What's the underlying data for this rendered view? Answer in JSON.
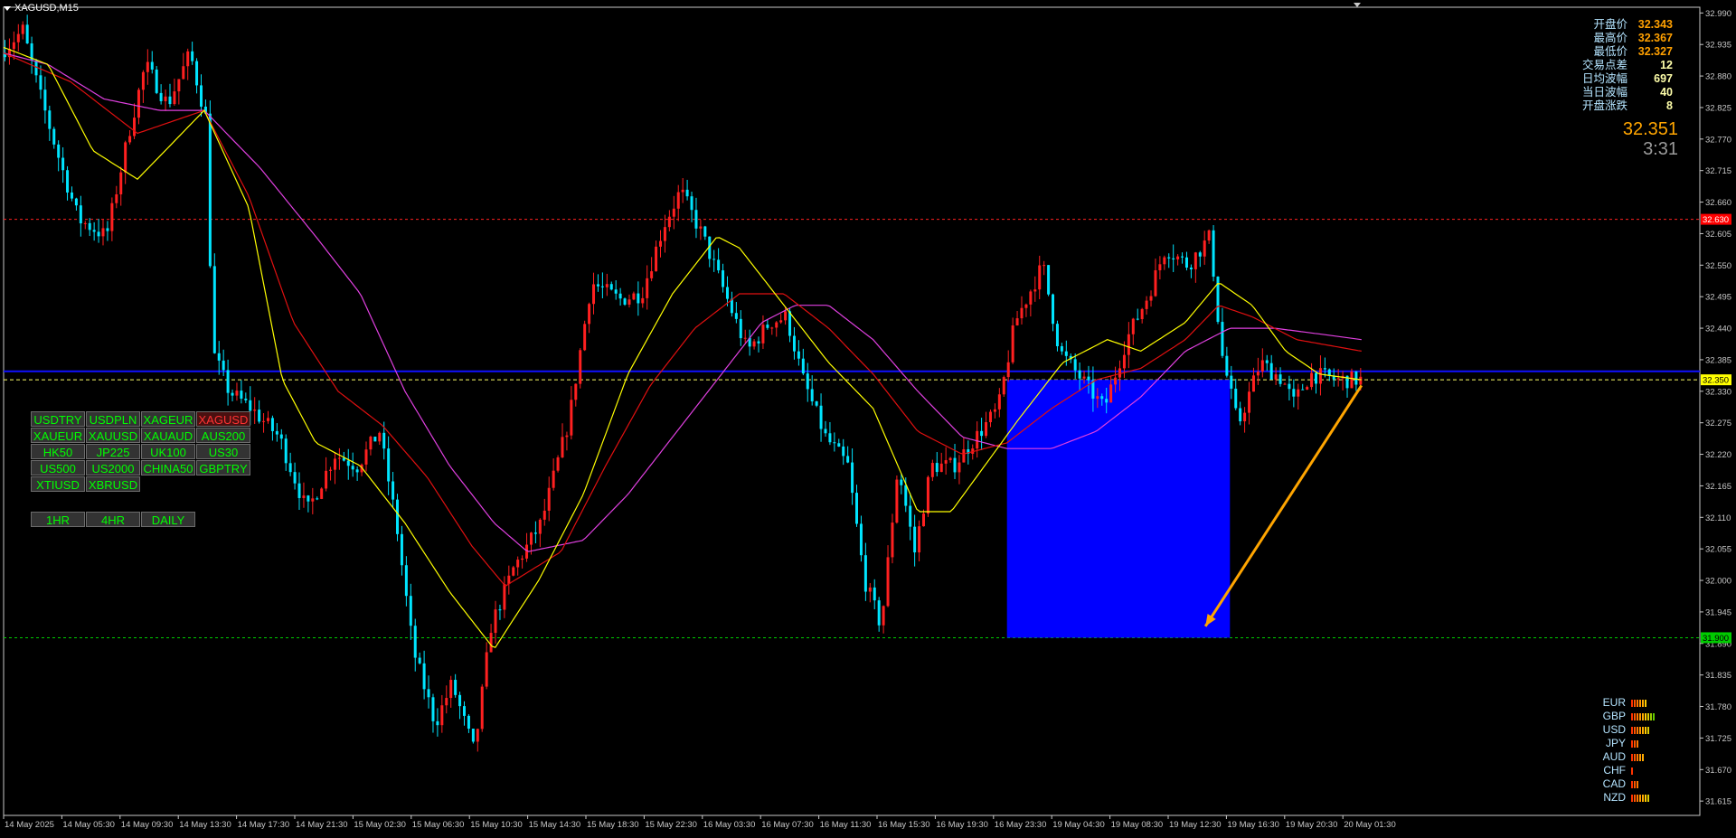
{
  "title": "XAGUSD,M15",
  "colors": {
    "background": "#000000",
    "bull": "#ff2020",
    "bear": "#00e5ff",
    "ma_fast": "#ffff00",
    "ma_mid": "#e01010",
    "ma_slow": "#e040e0",
    "resistance": "#ff2020",
    "support": "#00cc00",
    "current": "#ffff66",
    "blue_line": "#1010ff",
    "target_box": "#0000ff",
    "arrow": "#ffa500"
  },
  "symbols": {
    "rows": [
      [
        "USDTRY",
        "USDPLN",
        "XAGEUR",
        "XAGUSD"
      ],
      [
        "XAUEUR",
        "XAUUSD",
        "XAUAUD",
        "AUS200"
      ],
      [
        "HK50",
        "JP225",
        "UK100",
        "US30"
      ],
      [
        "US500",
        "US2000",
        "CHINA50",
        "GBPTRY"
      ],
      [
        "XTIUSD",
        "XBRUSD"
      ]
    ],
    "active": "XAGUSD"
  },
  "timeframes": [
    "1HR",
    "4HR",
    "DAILY"
  ],
  "info_panel": [
    {
      "label": "开盘价",
      "value": "32.343"
    },
    {
      "label": "最高价",
      "value": "32.367"
    },
    {
      "label": "最低价",
      "value": "32.327"
    },
    {
      "label": "交易点差",
      "value": "12"
    },
    {
      "label": "日均波幅",
      "value": "697"
    },
    {
      "label": "当日波幅",
      "value": "40"
    },
    {
      "label": "开盘涨跌",
      "value": "8"
    }
  ],
  "big_price": "32.351",
  "timer": "3:31",
  "currency_strength": [
    {
      "name": "EUR",
      "level": 6
    },
    {
      "name": "GBP",
      "level": 9
    },
    {
      "name": "USD",
      "level": 7
    },
    {
      "name": "JPY",
      "level": 3
    },
    {
      "name": "AUD",
      "level": 5
    },
    {
      "name": "CHF",
      "level": 1
    },
    {
      "name": "CAD",
      "level": 3
    },
    {
      "name": "NZD",
      "level": 7
    }
  ],
  "price_labels": {
    "resistance": "32.630",
    "current": "32.350",
    "support": "31.900"
  },
  "chart_data": {
    "type": "candlestick",
    "symbol": "XAGUSD",
    "timeframe": "M15",
    "ylim": [
      31.59,
      33.0
    ],
    "y_ticks": [
      "32.990",
      "32.935",
      "32.880",
      "32.825",
      "32.770",
      "32.715",
      "32.660",
      "32.605",
      "32.550",
      "32.495",
      "32.440",
      "32.385",
      "32.330",
      "32.275",
      "32.220",
      "32.165",
      "32.110",
      "32.055",
      "32.000",
      "31.945",
      "31.890",
      "31.835",
      "31.780",
      "31.725",
      "31.670",
      "31.615"
    ],
    "x_labels": [
      "14 May 2025",
      "14 May 05:30",
      "14 May 09:30",
      "14 May 13:30",
      "14 May 17:30",
      "14 May 21:30",
      "15 May 02:30",
      "15 May 06:30",
      "15 May 10:30",
      "15 May 14:30",
      "15 May 18:30",
      "15 May 22:30",
      "16 May 03:30",
      "16 May 07:30",
      "16 May 11:30",
      "16 May 15:30",
      "16 May 19:30",
      "16 May 23:30",
      "19 May 04:30",
      "19 May 08:30",
      "19 May 12:30",
      "19 May 16:30",
      "19 May 20:30",
      "20 May 01:30"
    ],
    "resistance_level": 32.63,
    "current_price": 32.35,
    "support_level": 31.9,
    "blue_line_level": 32.36,
    "price_path": [
      [
        0,
        32.92
      ],
      [
        20,
        32.96
      ],
      [
        35,
        32.85
      ],
      [
        55,
        32.72
      ],
      [
        70,
        32.63
      ],
      [
        95,
        32.6
      ],
      [
        115,
        32.78
      ],
      [
        130,
        32.9
      ],
      [
        150,
        32.83
      ],
      [
        170,
        32.92
      ],
      [
        185,
        32.8
      ],
      [
        190,
        32.4
      ],
      [
        205,
        32.33
      ],
      [
        225,
        32.3
      ],
      [
        250,
        32.25
      ],
      [
        275,
        32.12
      ],
      [
        300,
        32.22
      ],
      [
        320,
        32.2
      ],
      [
        340,
        32.26
      ],
      [
        355,
        32.1
      ],
      [
        370,
        31.88
      ],
      [
        390,
        31.75
      ],
      [
        405,
        31.82
      ],
      [
        425,
        31.7
      ],
      [
        440,
        31.92
      ],
      [
        460,
        32.02
      ],
      [
        485,
        32.1
      ],
      [
        510,
        32.28
      ],
      [
        530,
        32.52
      ],
      [
        555,
        32.49
      ],
      [
        575,
        32.5
      ],
      [
        595,
        32.62
      ],
      [
        610,
        32.68
      ],
      [
        630,
        32.6
      ],
      [
        650,
        32.5
      ],
      [
        670,
        32.4
      ],
      [
        690,
        32.45
      ],
      [
        705,
        32.46
      ],
      [
        720,
        32.35
      ],
      [
        740,
        32.25
      ],
      [
        760,
        32.2
      ],
      [
        775,
        32.0
      ],
      [
        790,
        31.92
      ],
      [
        805,
        32.2
      ],
      [
        820,
        32.05
      ],
      [
        835,
        32.2
      ],
      [
        855,
        32.2
      ],
      [
        875,
        32.25
      ],
      [
        895,
        32.3
      ],
      [
        910,
        32.45
      ],
      [
        935,
        32.55
      ],
      [
        950,
        32.4
      ],
      [
        970,
        32.35
      ],
      [
        990,
        32.3
      ],
      [
        1010,
        32.42
      ],
      [
        1030,
        32.5
      ],
      [
        1045,
        32.58
      ],
      [
        1065,
        32.55
      ],
      [
        1085,
        32.6
      ],
      [
        1095,
        32.4
      ],
      [
        1110,
        32.27
      ],
      [
        1130,
        32.38
      ],
      [
        1150,
        32.35
      ],
      [
        1160,
        32.31
      ],
      [
        1175,
        32.36
      ],
      [
        1200,
        32.35
      ],
      [
        1218,
        32.35
      ]
    ],
    "ma_fast_path": [
      [
        0,
        32.93
      ],
      [
        40,
        32.9
      ],
      [
        80,
        32.75
      ],
      [
        120,
        32.7
      ],
      [
        160,
        32.78
      ],
      [
        180,
        32.82
      ],
      [
        220,
        32.65
      ],
      [
        250,
        32.35
      ],
      [
        280,
        32.24
      ],
      [
        320,
        32.2
      ],
      [
        360,
        32.1
      ],
      [
        400,
        31.98
      ],
      [
        440,
        31.88
      ],
      [
        480,
        32.0
      ],
      [
        520,
        32.15
      ],
      [
        560,
        32.36
      ],
      [
        600,
        32.5
      ],
      [
        640,
        32.6
      ],
      [
        660,
        32.58
      ],
      [
        700,
        32.48
      ],
      [
        740,
        32.38
      ],
      [
        780,
        32.3
      ],
      [
        820,
        32.12
      ],
      [
        850,
        32.12
      ],
      [
        880,
        32.2
      ],
      [
        910,
        32.28
      ],
      [
        950,
        32.38
      ],
      [
        990,
        32.42
      ],
      [
        1020,
        32.4
      ],
      [
        1060,
        32.45
      ],
      [
        1090,
        32.52
      ],
      [
        1120,
        32.48
      ],
      [
        1150,
        32.4
      ],
      [
        1180,
        32.36
      ],
      [
        1218,
        32.35
      ]
    ],
    "ma_mid_path": [
      [
        0,
        32.92
      ],
      [
        60,
        32.87
      ],
      [
        120,
        32.78
      ],
      [
        180,
        32.82
      ],
      [
        220,
        32.67
      ],
      [
        260,
        32.45
      ],
      [
        300,
        32.33
      ],
      [
        340,
        32.27
      ],
      [
        380,
        32.18
      ],
      [
        420,
        32.06
      ],
      [
        450,
        31.99
      ],
      [
        500,
        32.05
      ],
      [
        540,
        32.2
      ],
      [
        580,
        32.34
      ],
      [
        620,
        32.44
      ],
      [
        660,
        32.5
      ],
      [
        700,
        32.5
      ],
      [
        740,
        32.44
      ],
      [
        780,
        32.36
      ],
      [
        820,
        32.26
      ],
      [
        860,
        32.22
      ],
      [
        900,
        32.24
      ],
      [
        940,
        32.3
      ],
      [
        980,
        32.35
      ],
      [
        1020,
        32.37
      ],
      [
        1060,
        32.42
      ],
      [
        1090,
        32.48
      ],
      [
        1120,
        32.46
      ],
      [
        1160,
        32.42
      ],
      [
        1218,
        32.4
      ]
    ],
    "ma_slow_path": [
      [
        0,
        32.92
      ],
      [
        40,
        32.9
      ],
      [
        90,
        32.84
      ],
      [
        140,
        32.82
      ],
      [
        180,
        32.82
      ],
      [
        230,
        32.72
      ],
      [
        280,
        32.6
      ],
      [
        320,
        32.5
      ],
      [
        360,
        32.33
      ],
      [
        400,
        32.2
      ],
      [
        440,
        32.1
      ],
      [
        470,
        32.05
      ],
      [
        520,
        32.07
      ],
      [
        560,
        32.15
      ],
      [
        600,
        32.25
      ],
      [
        640,
        32.35
      ],
      [
        680,
        32.45
      ],
      [
        710,
        32.48
      ],
      [
        740,
        32.48
      ],
      [
        780,
        32.42
      ],
      [
        820,
        32.33
      ],
      [
        860,
        32.25
      ],
      [
        900,
        32.23
      ],
      [
        940,
        32.23
      ],
      [
        980,
        32.26
      ],
      [
        1020,
        32.32
      ],
      [
        1060,
        32.4
      ],
      [
        1100,
        32.44
      ],
      [
        1140,
        32.44
      ],
      [
        1180,
        32.43
      ],
      [
        1218,
        32.42
      ]
    ],
    "forecast_box": {
      "price_top": 32.35,
      "price_bottom": 31.9
    },
    "forecast_arrow": {
      "from_price": 32.34,
      "to_price": 31.92
    }
  }
}
